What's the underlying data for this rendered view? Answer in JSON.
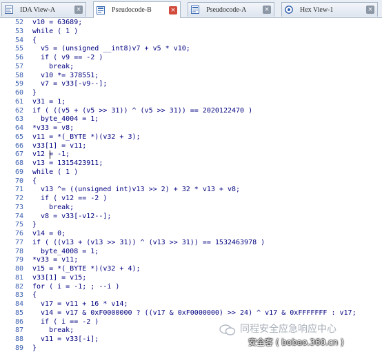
{
  "tabs": [
    {
      "label": "IDA View-A",
      "icon": "ida-view-icon",
      "active": false
    },
    {
      "label": "Pseudocode-B",
      "icon": "pseudocode-icon",
      "active": true
    },
    {
      "label": "Pseudocode-A",
      "icon": "pseudocode-icon",
      "active": false
    },
    {
      "label": "Hex View-1",
      "icon": "hex-view-icon",
      "active": false
    }
  ],
  "close_glyph": "×",
  "code": [
    {
      "n": "52",
      "t": "v10 = 63689;"
    },
    {
      "n": "53",
      "t": "while ( 1 )"
    },
    {
      "n": "54",
      "t": "{"
    },
    {
      "n": "55",
      "t": "  v5 = (unsigned __int8)v7 + v5 * v10;"
    },
    {
      "n": "56",
      "t": "  if ( v9 == -2 )"
    },
    {
      "n": "57",
      "t": "    break;"
    },
    {
      "n": "58",
      "t": "  v10 *= 378551;"
    },
    {
      "n": "59",
      "t": "  v7 = v33[-v9--];"
    },
    {
      "n": "60",
      "t": "}"
    },
    {
      "n": "61",
      "t": "v31 = 1;"
    },
    {
      "n": "62",
      "t": "if ( ((v5 + (v5 >> 31)) ^ (v5 >> 31)) == 2020122470 )"
    },
    {
      "n": "63",
      "t": "  byte_4004 = 1;"
    },
    {
      "n": "64",
      "t": "*v33 = v8;"
    },
    {
      "n": "65",
      "t": "v11 = *(_BYTE *)(v32 + 3);"
    },
    {
      "n": "66",
      "t": "v33[1] = v11;"
    },
    {
      "n": "67",
      "t": "v12 = -1;"
    },
    {
      "n": "68",
      "t": "v13 = 1315423911;"
    },
    {
      "n": "69",
      "t": "while ( 1 )"
    },
    {
      "n": "70",
      "t": "{"
    },
    {
      "n": "71",
      "t": "  v13 ^= ((unsigned int)v13 >> 2) + 32 * v13 + v8;"
    },
    {
      "n": "72",
      "t": "  if ( v12 == -2 )"
    },
    {
      "n": "73",
      "t": "    break;"
    },
    {
      "n": "74",
      "t": "  v8 = v33[-v12--];"
    },
    {
      "n": "75",
      "t": "}"
    },
    {
      "n": "76",
      "t": "v14 = 0;"
    },
    {
      "n": "77",
      "t": "if ( ((v13 + (v13 >> 31)) ^ (v13 >> 31)) == 1532463978 )"
    },
    {
      "n": "78",
      "t": "  byte_4008 = 1;"
    },
    {
      "n": "79",
      "t": "*v33 = v11;"
    },
    {
      "n": "80",
      "t": "v15 = *(_BYTE *)(v32 + 4);"
    },
    {
      "n": "81",
      "t": "v33[1] = v15;"
    },
    {
      "n": "82",
      "t": "for ( i = -1; ; --i )"
    },
    {
      "n": "83",
      "t": "{"
    },
    {
      "n": "84",
      "t": "  v17 = v11 + 16 * v14;"
    },
    {
      "n": "85",
      "t": "  v14 = v17 & 0xF0000000 ? ((v17 & 0xF0000000) >> 24) ^ v17 & 0xFFFFFFF : v17;"
    },
    {
      "n": "86",
      "t": "  if ( i == -2 )"
    },
    {
      "n": "87",
      "t": "    break;"
    },
    {
      "n": "88",
      "t": "  v11 = v33[-i];"
    },
    {
      "n": "89",
      "t": "}"
    }
  ],
  "watermark": {
    "title": "同程安全应急响应中心",
    "subtitle": "安全客 ( bobao.360.cn )"
  },
  "colors": {
    "code_text": "#000080",
    "line_number": "#3a5fb0",
    "tab_close_active": "#d14a3a"
  }
}
